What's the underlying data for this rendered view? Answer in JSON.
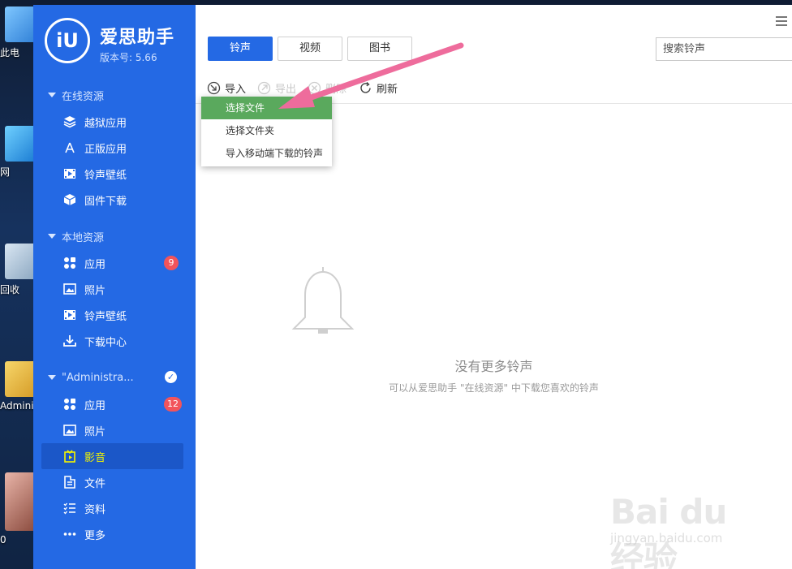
{
  "app": {
    "logo_text": "iU",
    "brand": "爱思助手",
    "version": "版本号: 5.66"
  },
  "desktop": {
    "icons": [
      {
        "label": "此电"
      },
      {
        "label": "网"
      },
      {
        "label": "回收"
      },
      {
        "label": "Adminis"
      },
      {
        "label": "0"
      }
    ]
  },
  "sidebar": {
    "sections": [
      {
        "label": "在线资源"
      },
      {
        "label": "本地资源"
      },
      {
        "label": "\"Administra..."
      }
    ],
    "online": [
      {
        "label": "越狱应用"
      },
      {
        "label": "正版应用"
      },
      {
        "label": "铃声壁纸"
      },
      {
        "label": "固件下载"
      }
    ],
    "local": [
      {
        "label": "应用",
        "badge": "9"
      },
      {
        "label": "照片"
      },
      {
        "label": "铃声壁纸"
      },
      {
        "label": "下载中心"
      }
    ],
    "device": [
      {
        "label": "应用",
        "badge": "12"
      },
      {
        "label": "照片"
      },
      {
        "label": "影音",
        "active": true
      },
      {
        "label": "文件"
      },
      {
        "label": "资料"
      },
      {
        "label": "更多"
      }
    ]
  },
  "tabs": [
    {
      "label": "铃声",
      "active": true
    },
    {
      "label": "视频"
    },
    {
      "label": "图书"
    }
  ],
  "search": {
    "placeholder": "搜索铃声"
  },
  "toolbar": {
    "import": "导入",
    "export": "导出",
    "delete": "删除",
    "refresh": "刷新"
  },
  "import_menu": [
    {
      "label": "选择文件",
      "highlighted": true
    },
    {
      "label": "选择文件夹"
    },
    {
      "label": "导入移动端下载的铃声"
    }
  ],
  "empty": {
    "title": "没有更多铃声",
    "subtitle": "可以从爱思助手 \"在线资源\" 中下载您喜欢的铃声"
  },
  "watermark": {
    "main": "Bai du 经验",
    "sub": "jingyan.baidu.com"
  },
  "colors": {
    "sidebar": "#2469e4",
    "active_item_text": "#f4f400",
    "primary": "#2469e4",
    "badge": "#f2545b",
    "menu_highlight": "#5aa95d",
    "arrow": "#ee6c9c"
  }
}
